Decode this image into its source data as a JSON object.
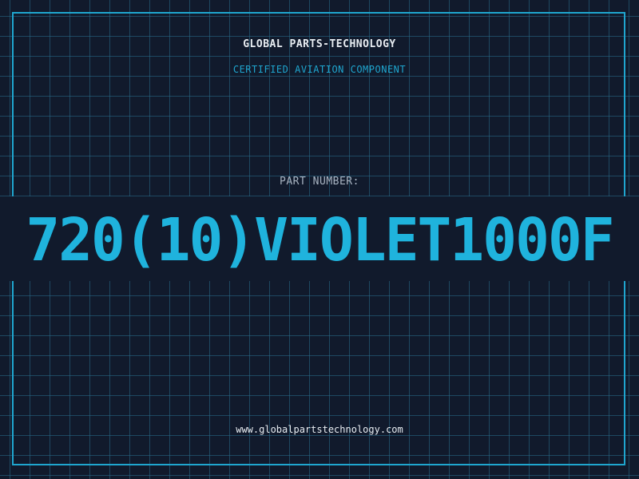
{
  "header": {
    "brand": "GLOBAL PARTS-TECHNOLOGY",
    "subtitle": "CERTIFIED AVIATION COMPONENT"
  },
  "part": {
    "label": "PART NUMBER:",
    "value": "720(10)VIOLET1000F"
  },
  "footer": {
    "url": "www.globalpartstechnology.com"
  },
  "colors": {
    "background": "#111a2c",
    "grid": "#286e8c",
    "accent": "#1fa6cf",
    "text": "#e8edf2"
  }
}
